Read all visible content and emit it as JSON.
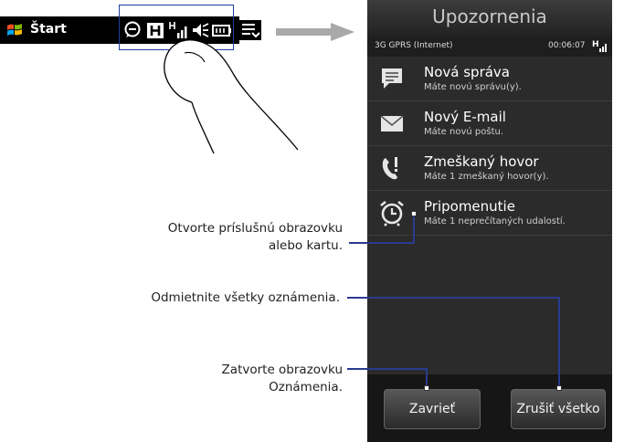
{
  "taskbar": {
    "start_label": "Štart",
    "icons": [
      "windows-logo-icon",
      "chat-bubble-icon",
      "h-network-icon",
      "signal-icon",
      "speaker-icon",
      "battery-icon",
      "menu-icon"
    ]
  },
  "screen": {
    "title": "Upozornenia",
    "status": {
      "connection": "3G GPRS (Internet)",
      "timer": "00:06:07",
      "signal_letter": "H"
    },
    "items": [
      {
        "title": "Nová správa",
        "subtitle": "Máte novú správu(y).",
        "icon": "message-icon"
      },
      {
        "title": "Nový E-mail",
        "subtitle": "Máte novú poštu.",
        "icon": "envelope-icon"
      },
      {
        "title": "Zmeškaný hovor",
        "subtitle": "Máte 1 zmeškaný hovor(y).",
        "icon": "missed-call-icon"
      },
      {
        "title": "Pripomenutie",
        "subtitle": "Máte 1 neprečítaných udalostí.",
        "icon": "alarm-clock-icon"
      }
    ],
    "buttons": {
      "close": "Zavrieť",
      "dismiss_all": "Zrušiť všetko"
    }
  },
  "callouts": {
    "open": [
      "Otvorte príslušnú obrazovku",
      "alebo kartu."
    ],
    "dismiss": "Odmietnite všetky oznámenia.",
    "close": [
      "Zatvorte obrazovku",
      "Oznámenia."
    ]
  }
}
